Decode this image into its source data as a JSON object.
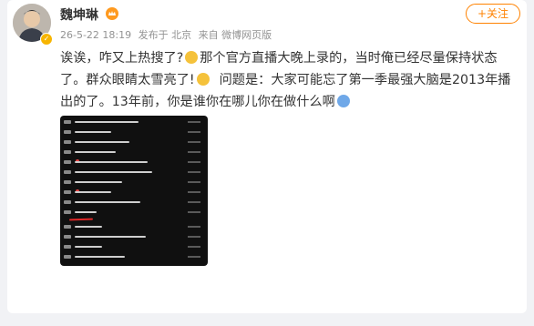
{
  "user": {
    "name": "魏坤琳",
    "vip_icon": "crown-icon",
    "avatar_icon": "user-avatar",
    "verified_icon": "verified-badge-icon"
  },
  "meta": {
    "date": "26-5-22 18:19",
    "published_from": "发布于 北京",
    "source": "来自 微博网页版"
  },
  "follow_label": "+关注",
  "post": {
    "part1": "诶诶，咋又上热搜了?",
    "part2": "那个官方直播大晚上录的，当时俺已经尽量保持状态了。群众眼睛太雪亮了!",
    "part3": "问题是：大家可能忘了第一季最强大脑是2013年播出的了。13年前，你是谁你在哪儿你在做什么啊",
    "emoji1": "laugh-emoji",
    "emoji2": "cry-emoji",
    "emoji3": "cool-emoji"
  },
  "colors": {
    "accent": "#ff8200",
    "text": "#333333",
    "meta": "#939393",
    "background": "#f1f2f5",
    "underline": "#e02828"
  }
}
